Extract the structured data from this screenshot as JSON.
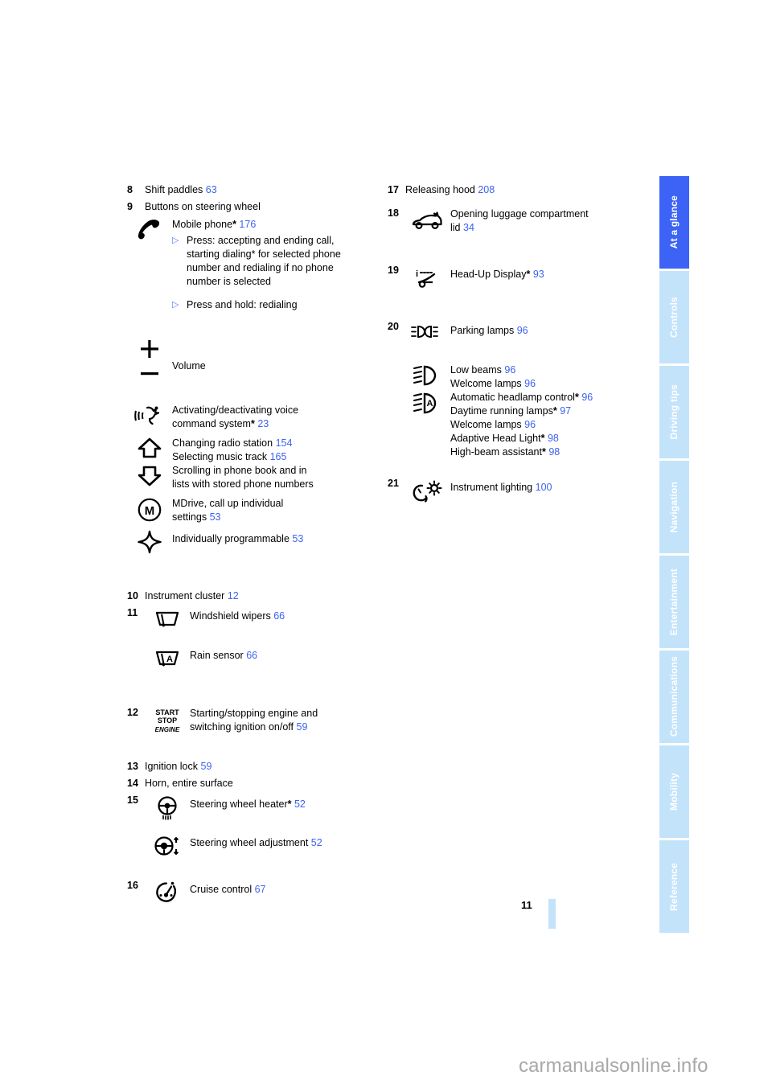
{
  "document": {
    "page_number": "11",
    "watermark": "carmanualsonline.info"
  },
  "sidebar": {
    "tabs": [
      {
        "label": "At a glance",
        "active": true
      },
      {
        "label": "Controls",
        "active": false
      },
      {
        "label": "Driving tips",
        "active": false
      },
      {
        "label": "Navigation",
        "active": false
      },
      {
        "label": "Entertainment",
        "active": false
      },
      {
        "label": "Communications",
        "active": false
      },
      {
        "label": "Mobility",
        "active": false
      },
      {
        "label": "Reference",
        "active": false
      }
    ],
    "active_color": "#3c63f5",
    "inactive_color": "#c3e3fa"
  },
  "colors": {
    "page_ref": "#3c63f0",
    "bullet": "#5b7cf5",
    "text": "#000000"
  },
  "left_column": {
    "item_8": {
      "number": "8",
      "label": "Shift paddles",
      "page": "63"
    },
    "item_9": {
      "number": "9",
      "label": "Buttons on steering wheel",
      "phone": {
        "icon": "phone-handset-icon",
        "label": "Mobile phone",
        "star": "*",
        "page": "176",
        "bullets": [
          "Press: accepting and ending call, starting dialing* for selected phone number and redialing if no phone number is selected",
          "Press and hold: redialing"
        ]
      },
      "volume": {
        "icon_plus": "plus-icon",
        "icon_minus": "minus-icon",
        "label": "Volume"
      },
      "voice": {
        "icon": "voice-command-icon",
        "line1": "Activating/deactivating voice",
        "line2": "command system",
        "star": "*",
        "page": "23"
      },
      "arrows": {
        "icon_up": "arrow-up-icon",
        "icon_down": "arrow-down-icon",
        "lines": [
          {
            "text": "Changing radio station",
            "page": "154"
          },
          {
            "text": "Selecting music track",
            "page": "165"
          },
          {
            "text": "Scrolling in phone book and in",
            "page": ""
          },
          {
            "text": "lists with stored phone numbers",
            "page": ""
          }
        ]
      },
      "mdrive": {
        "icon": "mdrive-m-circle-icon",
        "line1": "MDrive, call up individual",
        "line2": "settings",
        "page": "53"
      },
      "programmable": {
        "icon": "four-point-star-icon",
        "label": "Individually programmable",
        "page": "53"
      }
    },
    "item_10": {
      "number": "10",
      "label": "Instrument cluster",
      "page": "12"
    },
    "item_11": {
      "number": "11",
      "rows": [
        {
          "icon": "windshield-wiper-icon",
          "label": "Windshield wipers",
          "page": "66"
        },
        {
          "icon": "rain-sensor-icon",
          "label": "Rain sensor",
          "page": "66"
        }
      ]
    },
    "item_12": {
      "number": "12",
      "icon": "start-stop-engine-icon",
      "icon_text": {
        "l1": "START",
        "l2": "STOP",
        "l3": "ENGINE"
      },
      "line1": "Starting/stopping engine and",
      "line2": "switching ignition on/off",
      "page": "59"
    },
    "item_13": {
      "number": "13",
      "label": "Ignition lock",
      "page": "59"
    },
    "item_14": {
      "number": "14",
      "label": "Horn, entire surface",
      "page": ""
    },
    "item_15": {
      "number": "15",
      "rows": [
        {
          "icon": "steering-wheel-heater-icon",
          "label": "Steering wheel heater",
          "star": "*",
          "page": "52"
        },
        {
          "icon": "steering-wheel-adjustment-icon",
          "label": "Steering wheel adjustment",
          "star": "",
          "page": "52"
        }
      ]
    },
    "item_16": {
      "number": "16",
      "icon": "cruise-control-icon",
      "label": "Cruise control",
      "page": "67"
    }
  },
  "right_column": {
    "item_17": {
      "number": "17",
      "label": "Releasing hood",
      "page": "208"
    },
    "item_18": {
      "number": "18",
      "icon": "trunk-lid-icon",
      "line1": "Opening luggage compartment",
      "line2": "lid",
      "page": "34"
    },
    "item_19": {
      "number": "19",
      "icon": "head-up-display-icon",
      "label": "Head-Up Display",
      "star": "*",
      "page": "93"
    },
    "item_20": {
      "number": "20",
      "parking": {
        "icon": "parking-lamps-icon",
        "label": "Parking lamps",
        "page": "96"
      },
      "lamps": {
        "icon_low_beam": "low-beam-icon",
        "icon_auto_headlamp": "automatic-headlamp-icon",
        "lines": [
          {
            "text": "Low beams",
            "star": "",
            "page": "96"
          },
          {
            "text": "Welcome lamps",
            "star": "",
            "page": "96"
          },
          {
            "text": "Automatic headlamp control",
            "star": "*",
            "page": "96"
          },
          {
            "text": "Daytime running lamps",
            "star": "*",
            "page": "97"
          },
          {
            "text": "Welcome lamps",
            "star": "",
            "page": "96"
          },
          {
            "text": "Adaptive Head Light",
            "star": "*",
            "page": "98"
          },
          {
            "text": "High-beam assistant",
            "star": "*",
            "page": "98"
          }
        ]
      }
    },
    "item_21": {
      "number": "21",
      "icon": "instrument-lighting-icon",
      "label": "Instrument lighting",
      "page": "100"
    }
  }
}
